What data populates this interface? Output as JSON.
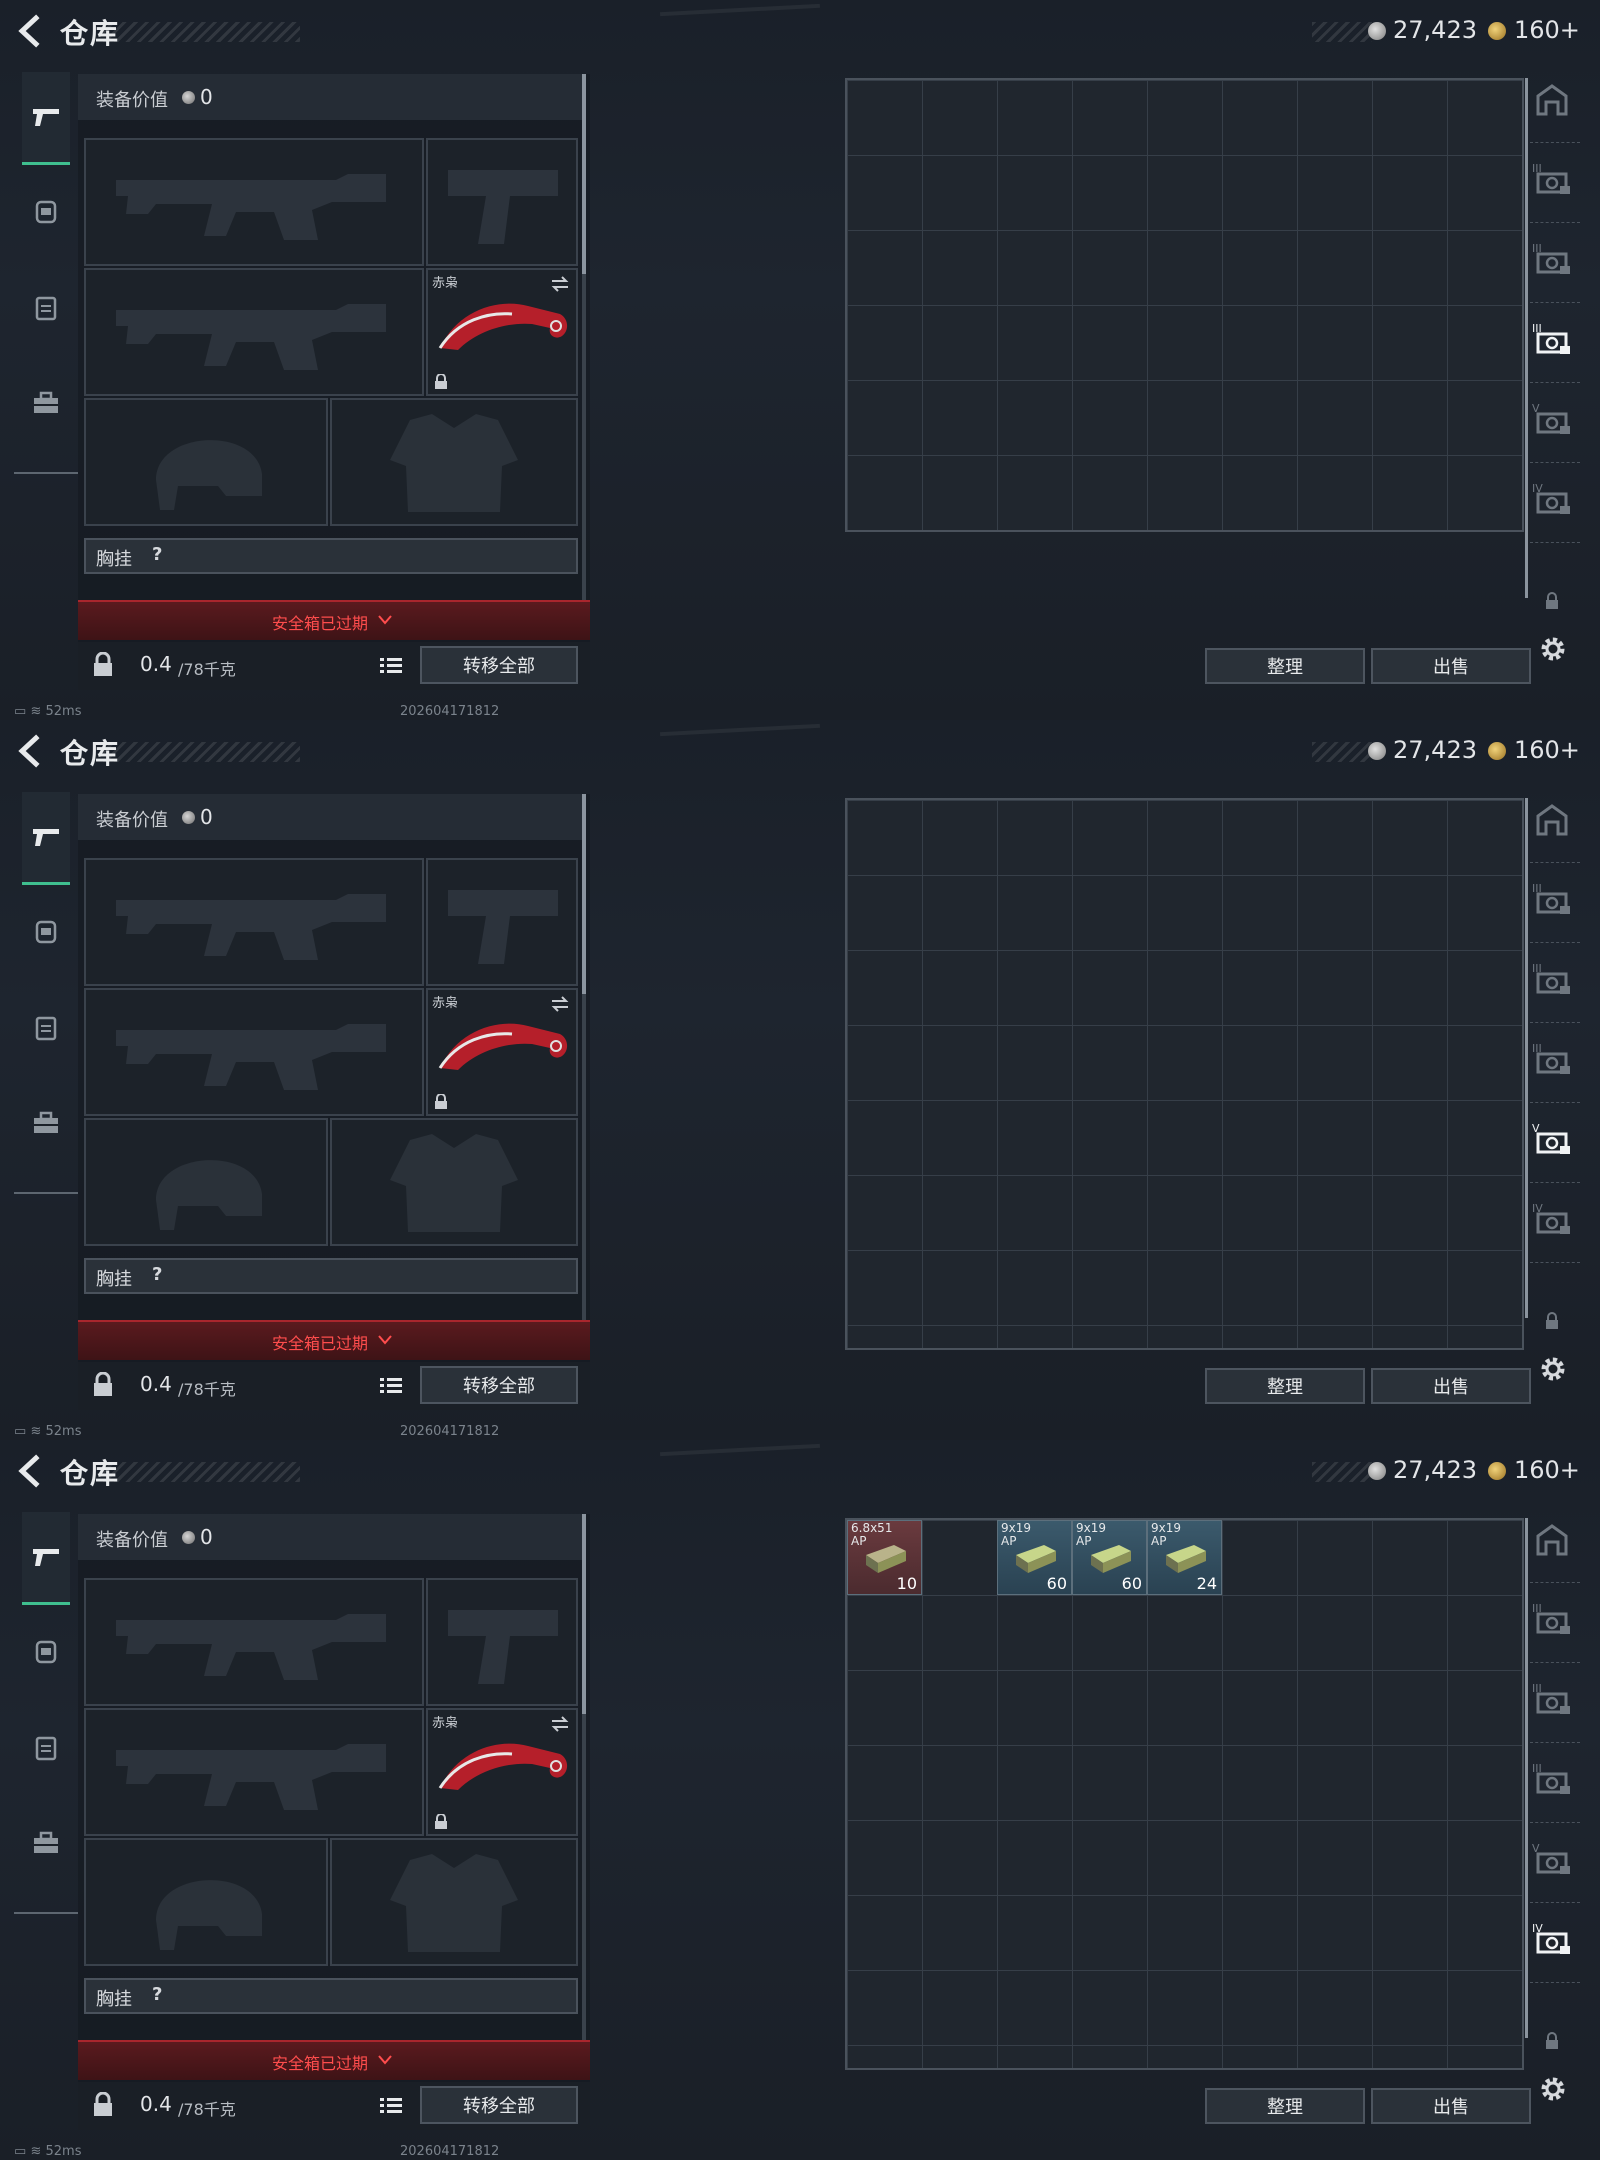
{
  "header": {
    "title": "仓库",
    "currency_silver": "27,423",
    "currency_gold": "160+"
  },
  "equipment": {
    "value_label": "装备价值",
    "value": "0",
    "knife_label": "赤枭",
    "chest_label": "胸挂",
    "chest_help": "?",
    "safe_box_expired": "安全箱已过期",
    "weight_current": "0.4",
    "weight_max": "/78千克",
    "transfer_all": "转移全部"
  },
  "stash": {
    "sort_button": "整理",
    "sell_button": "出售"
  },
  "status": {
    "ping": "52ms",
    "timestamp": "202604171812"
  },
  "screens": [
    {
      "active_rail": 3,
      "grid_rows": 6,
      "items": []
    },
    {
      "active_rail": 4,
      "grid_rows": 8,
      "items": []
    },
    {
      "active_rail": 5,
      "grid_rows": 8,
      "items": [
        {
          "caliber": "6.8x51",
          "sub": "AP",
          "count": "10",
          "color": "red",
          "col": 0
        },
        {
          "caliber": "9x19",
          "sub": "AP",
          "count": "60",
          "color": "blue",
          "col": 2
        },
        {
          "caliber": "9x19",
          "sub": "AP",
          "count": "60",
          "color": "blue",
          "col": 3
        },
        {
          "caliber": "9x19",
          "sub": "AP",
          "count": "24",
          "color": "blue",
          "col": 4
        }
      ]
    }
  ],
  "rail_icons": [
    "shelter-icon",
    "case-3-icon",
    "case-3b-icon",
    "case-3c-icon",
    "case-5-icon",
    "case-4-icon"
  ],
  "colors": {
    "accent_green": "#3fbf8f",
    "warning_red": "#ff4d4d",
    "background": "#1b2129"
  }
}
